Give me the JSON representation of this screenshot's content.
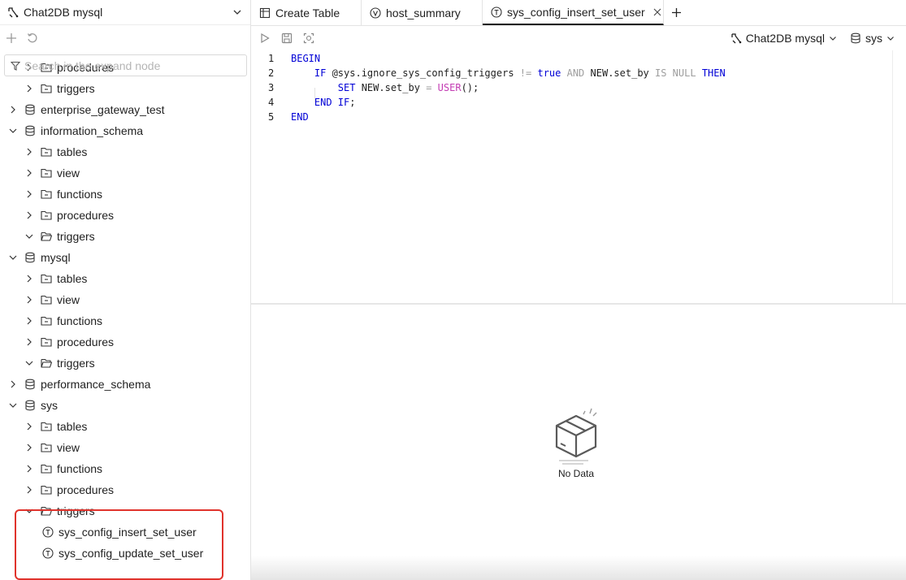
{
  "sidebar": {
    "connection_name": "Chat2DB mysql",
    "search_placeholder": "Search in the expand node",
    "tree": [
      {
        "label": "procedures",
        "kind": "folder",
        "level": 1,
        "expanded": false
      },
      {
        "label": "triggers",
        "kind": "folder",
        "level": 1,
        "expanded": false
      },
      {
        "label": "enterprise_gateway_test",
        "kind": "database",
        "level": 0,
        "expanded": false
      },
      {
        "label": "information_schema",
        "kind": "database",
        "level": 0,
        "expanded": true
      },
      {
        "label": "tables",
        "kind": "folder",
        "level": 1,
        "expanded": false
      },
      {
        "label": "view",
        "kind": "folder",
        "level": 1,
        "expanded": false
      },
      {
        "label": "functions",
        "kind": "folder",
        "level": 1,
        "expanded": false
      },
      {
        "label": "procedures",
        "kind": "folder",
        "level": 1,
        "expanded": false
      },
      {
        "label": "triggers",
        "kind": "folder",
        "level": 1,
        "expanded": true
      },
      {
        "label": "mysql",
        "kind": "database",
        "level": 0,
        "expanded": true
      },
      {
        "label": "tables",
        "kind": "folder",
        "level": 1,
        "expanded": false
      },
      {
        "label": "view",
        "kind": "folder",
        "level": 1,
        "expanded": false
      },
      {
        "label": "functions",
        "kind": "folder",
        "level": 1,
        "expanded": false
      },
      {
        "label": "procedures",
        "kind": "folder",
        "level": 1,
        "expanded": false
      },
      {
        "label": "triggers",
        "kind": "folder",
        "level": 1,
        "expanded": true
      },
      {
        "label": "performance_schema",
        "kind": "database",
        "level": 0,
        "expanded": false
      },
      {
        "label": "sys",
        "kind": "database",
        "level": 0,
        "expanded": true
      },
      {
        "label": "tables",
        "kind": "folder",
        "level": 1,
        "expanded": false
      },
      {
        "label": "view",
        "kind": "folder",
        "level": 1,
        "expanded": false
      },
      {
        "label": "functions",
        "kind": "folder",
        "level": 1,
        "expanded": false
      },
      {
        "label": "procedures",
        "kind": "folder",
        "level": 1,
        "expanded": false
      },
      {
        "label": "triggers",
        "kind": "folder",
        "level": 1,
        "expanded": true
      },
      {
        "label": "sys_config_insert_set_user",
        "kind": "trigger",
        "level": 2,
        "selected": true
      },
      {
        "label": "sys_config_update_set_user",
        "kind": "trigger",
        "level": 2
      }
    ]
  },
  "tabs": [
    {
      "label": "Create Table",
      "icon": "table-icon",
      "active": false
    },
    {
      "label": "host_summary",
      "icon": "view-icon",
      "active": false
    },
    {
      "label": "sys_config_insert_set_user",
      "icon": "trigger-icon",
      "active": true,
      "closable": true
    }
  ],
  "editor_toolbar": {
    "connection_label": "Chat2DB mysql",
    "database_label": "sys"
  },
  "code": {
    "line_numbers": [
      "1",
      "2",
      "3",
      "4",
      "5"
    ],
    "lines": [
      [
        [
          "kw",
          "BEGIN"
        ]
      ],
      [
        [
          "sp",
          "    "
        ],
        [
          "kw",
          "IF"
        ],
        [
          "id",
          " @sys.ignore_sys_config_triggers "
        ],
        [
          "op",
          "!="
        ],
        [
          "id",
          " "
        ],
        [
          "kw",
          "true"
        ],
        [
          "id",
          " "
        ],
        [
          "op",
          "AND"
        ],
        [
          "id",
          " NEW.set_by "
        ],
        [
          "op",
          "IS NULL"
        ],
        [
          "id",
          " "
        ],
        [
          "kw",
          "THEN"
        ]
      ],
      [
        [
          "sp",
          "        "
        ],
        [
          "kw",
          "SET"
        ],
        [
          "id",
          " NEW.set_by "
        ],
        [
          "op",
          "="
        ],
        [
          "id",
          " "
        ],
        [
          "fn",
          "USER"
        ],
        [
          "id",
          "();"
        ]
      ],
      [
        [
          "sp",
          "    "
        ],
        [
          "kw",
          "END IF"
        ],
        [
          "id",
          ";"
        ]
      ],
      [
        [
          "kw",
          "END"
        ]
      ]
    ]
  },
  "results": {
    "empty_text": "No Data"
  },
  "colors": {
    "keyword": "#0000d6",
    "operator": "#9e9e9e",
    "function": "#c33cb3",
    "highlight_border": "#e0332c",
    "selection": "#e3e3e3"
  }
}
